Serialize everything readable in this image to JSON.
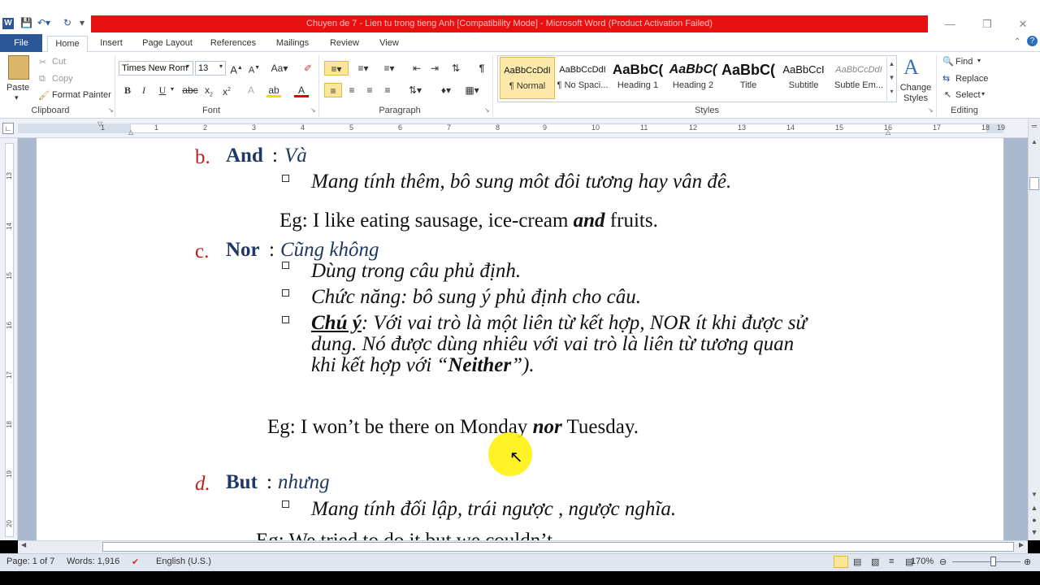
{
  "window": {
    "title": "Chuyen de 7 - Lien tu trong tieng Anh [Compatibility Mode]  -  Microsoft Word (Product Activation Failed)",
    "minimize": "—",
    "restore": "❐",
    "close": "✕"
  },
  "tabs": [
    "File",
    "Home",
    "Insert",
    "Page Layout",
    "References",
    "Mailings",
    "Review",
    "View"
  ],
  "clipboard": {
    "paste": "Paste",
    "cut": "Cut",
    "copy": "Copy",
    "format_painter": "Format Painter",
    "label": "Clipboard"
  },
  "font": {
    "name": "Times New Rom",
    "size": "13",
    "label": "Font"
  },
  "paragraph": {
    "label": "Paragraph"
  },
  "styles": {
    "label": "Styles",
    "items": [
      {
        "preview": "AaBbCcDdI",
        "name": "¶ Normal"
      },
      {
        "preview": "AaBbCcDdI",
        "name": "¶ No Spaci..."
      },
      {
        "preview": "AaBbC(",
        "name": "Heading 1"
      },
      {
        "preview": "AaBbC(",
        "name": "Heading 2"
      },
      {
        "preview": "AaBbC(",
        "name": "Title"
      },
      {
        "preview": "AaBbCcI",
        "name": "Subtitle"
      },
      {
        "preview": "AaBbCcDdI",
        "name": "Subtle Em..."
      }
    ],
    "change_styles": "Change Styles"
  },
  "editing": {
    "find": "Find",
    "replace": "Replace",
    "select": "Select",
    "label": "Editing"
  },
  "ruler": {
    "numbers": [
      "1",
      "1",
      "2",
      "3",
      "4",
      "5",
      "6",
      "7",
      "8",
      "9",
      "10",
      "11",
      "12",
      "13",
      "14",
      "15",
      "16",
      "17",
      "18",
      "19"
    ]
  },
  "vruler": {
    "numbers": [
      "13",
      "14",
      "15",
      "16",
      "17",
      "18",
      "19",
      "20"
    ]
  },
  "document": {
    "b_marker": "b.",
    "b_word": "And",
    "b_colon": ":",
    "b_meaning": "Và",
    "b_point1": "Mang tính thêm, bô sung môt đôi tương hay vân đê.",
    "b_eg_pre": "Eg: I like eating sausage, ice-cream ",
    "b_eg_em": "and",
    "b_eg_post": " fruits.",
    "c_marker": "c.",
    "c_word": "Nor",
    "c_colon": ":",
    "c_meaning": "Cũng không",
    "c_point1": "Dùng trong câu phủ định.",
    "c_point2": "Chức năng: bô sung ý phủ định cho câu.",
    "c_point3_label": "Chú ý",
    "c_point3_line1": ": Với vai trò là một liên từ kết hợp, NOR ít khi được sử",
    "c_point3_line2": "dung. Nó được dùng nhiêu với vai trò là liên từ tương quan",
    "c_point3_line3_pre": "khi kết hợp với “",
    "c_point3_line3_em": "Neither",
    "c_point3_line3_post": "”).",
    "c_eg_pre": "Eg: I won’t be there on Monday ",
    "c_eg_em": "nor",
    "c_eg_post": " Tuesday.",
    "d_marker": "d.",
    "d_word": "But",
    "d_colon": ":",
    "d_meaning": "nhưng",
    "d_point1": "Mang tính đối lập, trái ngược , ngược nghĩa.",
    "d_eg": "Eg: We tried to do it but we couldn’t."
  },
  "status": {
    "page": "Page: 1 of 7",
    "words": "Words: 1,916",
    "language": "English (U.S.)",
    "zoom": "170%"
  }
}
